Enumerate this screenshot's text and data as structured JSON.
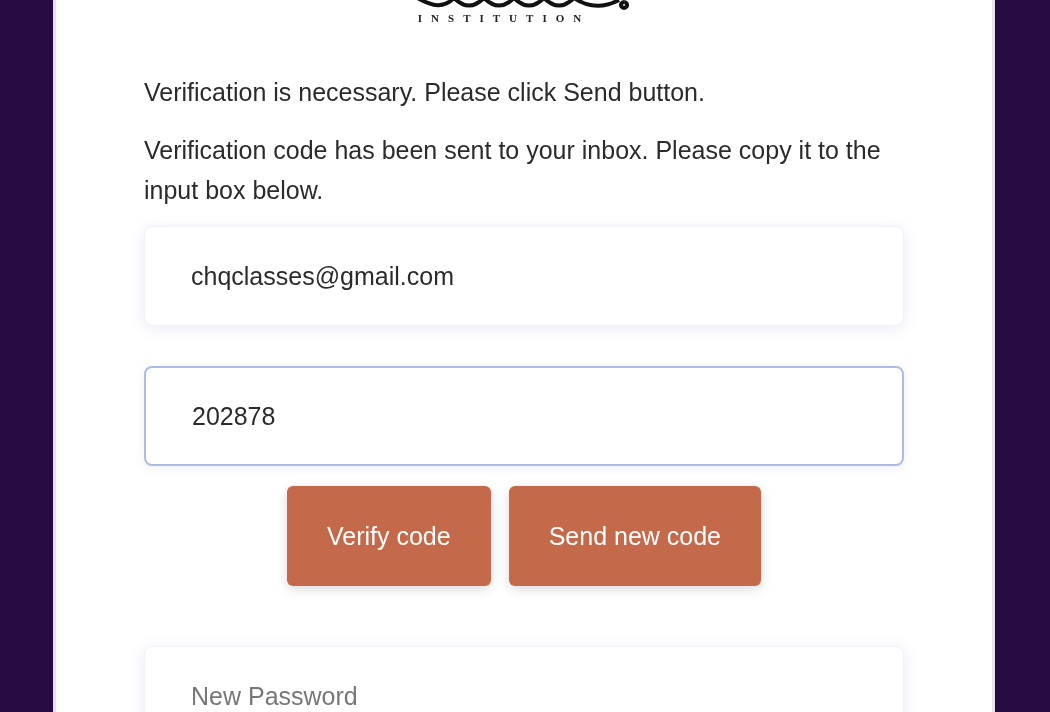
{
  "logo": {
    "caption": "INSTITUTION"
  },
  "messages": [
    "Verification is necessary. Please click Send button.",
    "Verification code has been sent to your inbox. Please copy it to the input box below."
  ],
  "email_field": {
    "value": "chqclasses@gmail.com",
    "focused": false
  },
  "code_field": {
    "value": "202878",
    "focused": true
  },
  "buttons": [
    "Verify code",
    "Send new code"
  ],
  "password_field": {
    "placeholder": "New Password"
  }
}
